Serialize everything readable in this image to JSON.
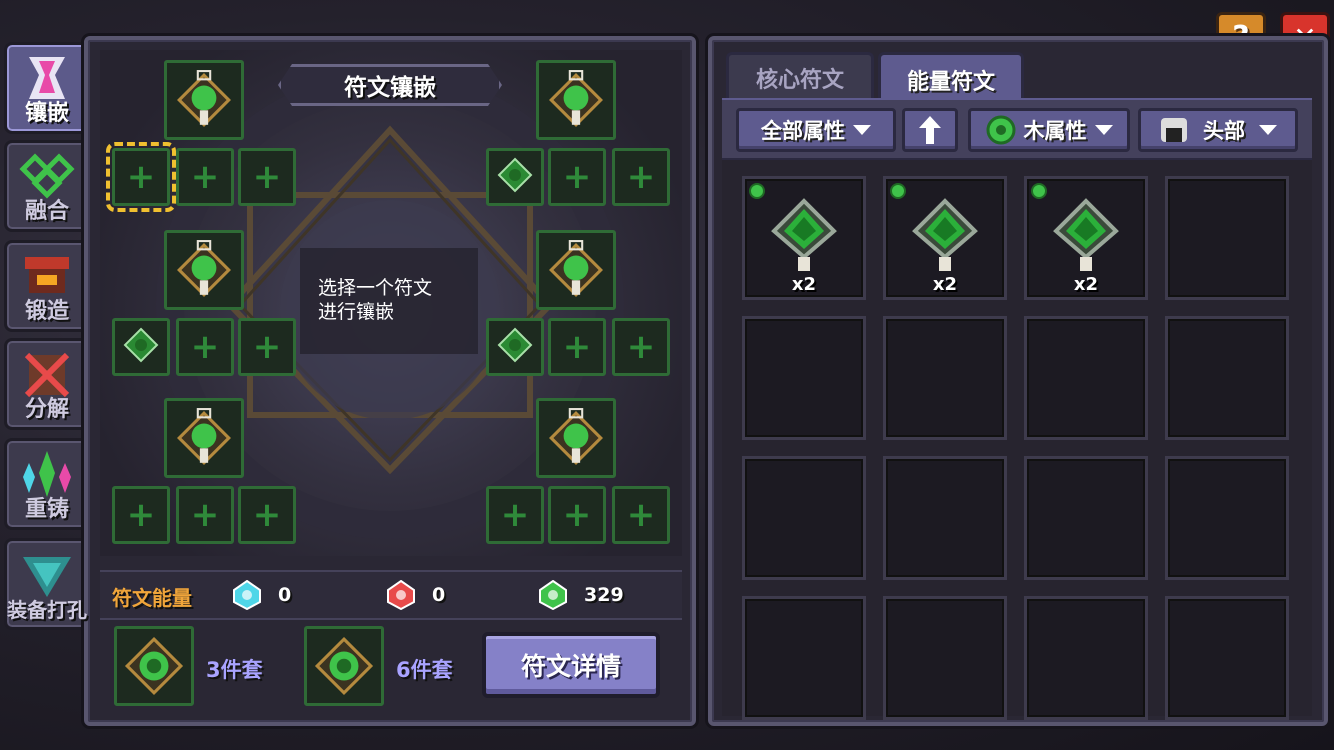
{
  "side_tabs": [
    {
      "label": "镶嵌",
      "icon": "inlay-icon",
      "active": true
    },
    {
      "label": "融合",
      "icon": "fusion-icon",
      "active": false
    },
    {
      "label": "锻造",
      "icon": "forge-icon",
      "active": false
    },
    {
      "label": "分解",
      "icon": "decompose-icon",
      "active": false
    },
    {
      "label": "重铸",
      "icon": "recast-icon",
      "active": false
    },
    {
      "label": "装备打孔",
      "icon": "socket-drill-icon",
      "active": false
    }
  ],
  "left_panel": {
    "title": "符文镶嵌",
    "hint": "选择一个符文进行镶嵌",
    "energy_label": "符文能量",
    "energy": [
      {
        "icon": "blue-energy-icon",
        "value": "0",
        "color": "#4fd6e8"
      },
      {
        "icon": "red-energy-icon",
        "value": "0",
        "color": "#e84a4a"
      },
      {
        "icon": "green-energy-icon",
        "value": "329",
        "color": "#3fc34a"
      }
    ],
    "sets": [
      {
        "label": "3件套"
      },
      {
        "label": "6件套"
      }
    ],
    "details_button": "符文详情"
  },
  "right_panel": {
    "tabs": [
      {
        "label": "核心符文",
        "active": false
      },
      {
        "label": "能量符文",
        "active": true
      }
    ],
    "filters": {
      "all_attr": "全部属性",
      "wood_attr": "木属性",
      "head": "头部"
    },
    "inventory": [
      {
        "count": "x2",
        "icon": "wood-energy-rune-icon"
      },
      {
        "count": "x2",
        "icon": "wood-energy-rune-icon"
      },
      {
        "count": "x2",
        "icon": "wood-energy-rune-icon"
      }
    ]
  },
  "top_buttons": {
    "help": "?",
    "close": "✕"
  }
}
